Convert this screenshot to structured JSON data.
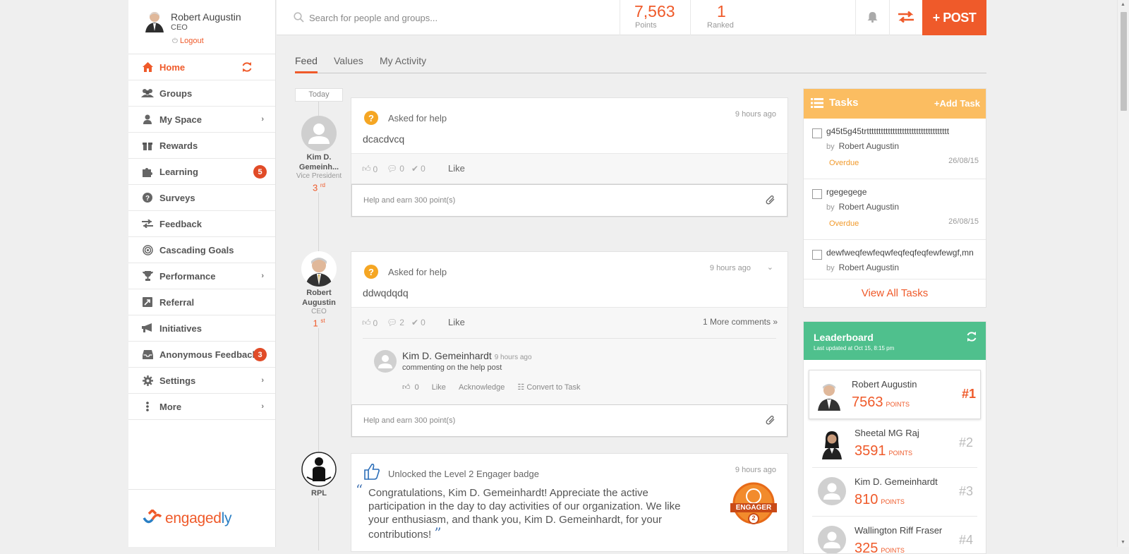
{
  "profile": {
    "name": "Robert Augustin",
    "role": "CEO",
    "logout": "Logout"
  },
  "sidebar": {
    "items": [
      {
        "label": "Home",
        "icon": "home-icon"
      },
      {
        "label": "Groups",
        "icon": "groups-icon"
      },
      {
        "label": "My Space",
        "icon": "user-icon"
      },
      {
        "label": "Rewards",
        "icon": "gift-icon"
      },
      {
        "label": "Learning",
        "icon": "puzzle-icon",
        "badge": "5"
      },
      {
        "label": "Surveys",
        "icon": "question-icon"
      },
      {
        "label": "Feedback",
        "icon": "swap-icon"
      },
      {
        "label": "Cascading Goals",
        "icon": "target-icon"
      },
      {
        "label": "Performance",
        "icon": "trophy-icon"
      },
      {
        "label": "Referral",
        "icon": "referral-icon"
      },
      {
        "label": "Initiatives",
        "icon": "megaphone-icon"
      },
      {
        "label": "Anonymous Feedback",
        "icon": "inbox-icon",
        "badge": "3"
      },
      {
        "label": "Settings",
        "icon": "gear-icon"
      },
      {
        "label": "More",
        "icon": "more-icon"
      }
    ],
    "logo": {
      "text_a": "engaged",
      "text_b": "ly"
    }
  },
  "search": {
    "placeholder": "Search for people and groups..."
  },
  "stats": {
    "points_value": "7,563",
    "points_label": "Points",
    "ranked_value": "1",
    "ranked_label": "Ranked"
  },
  "post_button": "+ POST",
  "tabs": [
    "Feed",
    "Values",
    "My Activity"
  ],
  "timeline": {
    "today": "Today"
  },
  "feed": [
    {
      "author": {
        "name": "Kim D. Gemeinh...",
        "role": "Vice President",
        "rank": "3",
        "rank_suffix": "rd"
      },
      "type": "Asked for help",
      "time": "9 hours ago",
      "body": "dcacdvcq",
      "likes": "0",
      "comments": "0",
      "checks": "0",
      "like_label": "Like",
      "footer": "Help and earn 300 point(s)"
    },
    {
      "author": {
        "name": "Robert Augustin",
        "role": "CEO",
        "rank": "1",
        "rank_suffix": "st"
      },
      "type": "Asked for help",
      "time": "9 hours ago",
      "body": "ddwqdqdq",
      "likes": "0",
      "comments": "2",
      "checks": "0",
      "like_label": "Like",
      "more_comments": "1 More comments",
      "comment": {
        "name": "Kim D. Gemeinhardt",
        "time": "9 hours ago",
        "text": "commenting on the help post",
        "likes": "0",
        "like": "Like",
        "acknowledge": "Acknowledge",
        "convert": "Convert to Task"
      },
      "footer": "Help and earn 300 point(s)"
    },
    {
      "author": {
        "name": "RPL"
      },
      "type": "Unlocked the Level 2 Engager badge",
      "time": "9 hours ago",
      "body": "Congratulations, Kim D.  Gemeinhardt! Appreciate the active participation in the day to day activities of our organization. We like your enthusiasm, and thank you, Kim D.  Gemeinhardt, for your contributions!",
      "badge_label": "ENGAGER",
      "badge_level": "2"
    }
  ],
  "tasks": {
    "title": "Tasks",
    "add": "+Add Task",
    "items": [
      {
        "title": "g45t5g45trttttttttttttttttttttttttttttttttttt",
        "by": "by",
        "owner": "Robert Augustin",
        "status": "Overdue",
        "date": "26/08/15"
      },
      {
        "title": "rgegegege",
        "by": "by",
        "owner": "Robert Augustin",
        "status": "Overdue",
        "date": "26/08/15"
      },
      {
        "title": "dewfweqfewfeqwfeqfeqfeqfewfewgf,mn",
        "by": "by",
        "owner": "Robert Augustin"
      }
    ],
    "view_all": "View All Tasks"
  },
  "leaderboard": {
    "title": "Leaderboard",
    "updated": "Last updated at Oct 15, 8:15 pm",
    "points_label": "POINTS",
    "rows": [
      {
        "name": "Robert Augustin",
        "points": "7563",
        "rank": "#1"
      },
      {
        "name": "Sheetal MG Raj",
        "points": "3591",
        "rank": "#2"
      },
      {
        "name": "Kim D. Gemeinhardt",
        "points": "810",
        "rank": "#3"
      },
      {
        "name": "Wallington Riff Fraser",
        "points": "325",
        "rank": "#4"
      }
    ]
  },
  "colors": {
    "accent": "#ef5a2a",
    "tasks_header": "#fbbd61",
    "leaderboard_header": "#4fc08d",
    "badge": "#e14b27"
  }
}
